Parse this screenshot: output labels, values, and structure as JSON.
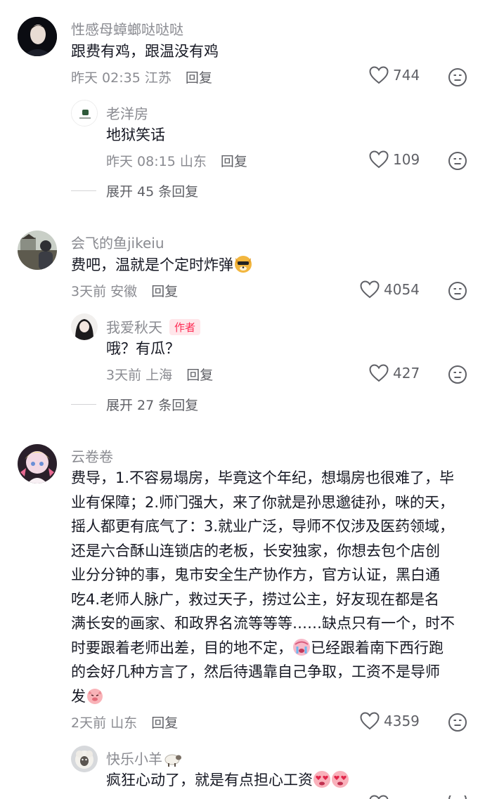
{
  "comments": [
    {
      "username": "性感母蟑螂哒哒哒",
      "text": "跟费有鸡，跟温没有鸡",
      "time": "昨天 02:35",
      "location": "江苏",
      "reply_label": "回复",
      "likes": "744",
      "replies": [
        {
          "username": "老洋房",
          "text": "地狱笑话",
          "time": "昨天 08:15",
          "location": "山东",
          "reply_label": "回复",
          "likes": "109"
        }
      ],
      "expand_label": "展开 45 条回复"
    },
    {
      "username": "会飞的鱼jikeiu",
      "text": "费吧，温就是个定时炸弹",
      "time": "3天前",
      "location": "安徽",
      "reply_label": "回复",
      "likes": "4054",
      "replies": [
        {
          "username": "我爱秋天",
          "badge": "作者",
          "text": "哦？有瓜？",
          "time": "3天前",
          "location": "上海",
          "reply_label": "回复",
          "likes": "427"
        }
      ],
      "expand_label": "展开 27 条回复"
    },
    {
      "username": "云卷卷",
      "text_lines": [
        "费导，1.不容易塌房，毕竟这个年纪，想塌房也很难了，毕",
        "业有保障；2.师门强大，来了你就是孙思邈徒孙，咪的天，",
        "摇人都更有底气了：3.就业广泛，导师不仅涉及医药领域，",
        "还是六合酥山连锁店的老板，长安独家，你想去包个店创",
        "业分分钟的事，鬼市安全生产协作方，官方认证，黑白通",
        "吃4.老师人脉广，救过天子，捞过公主，好友现在都是名",
        "满长安的画家、和政界名流等等等……缺点只有一个，时不",
        "时要跟着老师出差，目的地不定，",
        "已经跟着南下西行跑",
        "的会好几种方言了，然后待遇靠自己争取，工资不是导师",
        "发"
      ],
      "time": "2天前",
      "location": "山东",
      "reply_label": "回复",
      "likes": "4359",
      "replies": [
        {
          "username": "快乐小羊",
          "text": "疯狂心动了，就是有点担心工资"
        }
      ]
    }
  ],
  "colors": {
    "muted": "#8a8b91",
    "text": "#161823",
    "badge_text": "#fe2c55",
    "badge_bg": "#ffe6ea"
  },
  "icons": [
    "heart-outline-icon",
    "dislike-face-icon",
    "dog-sunglasses-emoji",
    "crying-emoji",
    "pink-pig-emoji",
    "heart-eyes-emoji",
    "sheep-emoji"
  ]
}
